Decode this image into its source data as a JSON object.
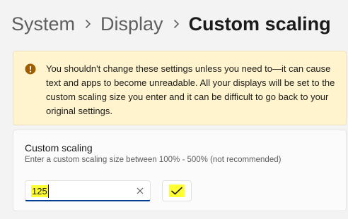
{
  "breadcrumb": {
    "items": [
      "System",
      "Display"
    ],
    "current": "Custom scaling"
  },
  "warning": {
    "icon": "warning-circle-icon",
    "icon_color": "#9d5d00",
    "text": "You shouldn't change these settings unless you need to—it can cause text and apps to become unreadable. All your displays will be set to the custom scaling size you enter and it can be difficult to go back to your original settings."
  },
  "custom_scaling": {
    "title": "Custom scaling",
    "description": "Enter a custom scaling size between 100% - 500% (not recommended)",
    "input_value": "125",
    "clear_icon": "close-icon",
    "confirm_icon": "checkmark-icon"
  },
  "colors": {
    "accent": "#003e92",
    "highlight": "#ffff33",
    "warning_bg": "#fff4ce"
  }
}
